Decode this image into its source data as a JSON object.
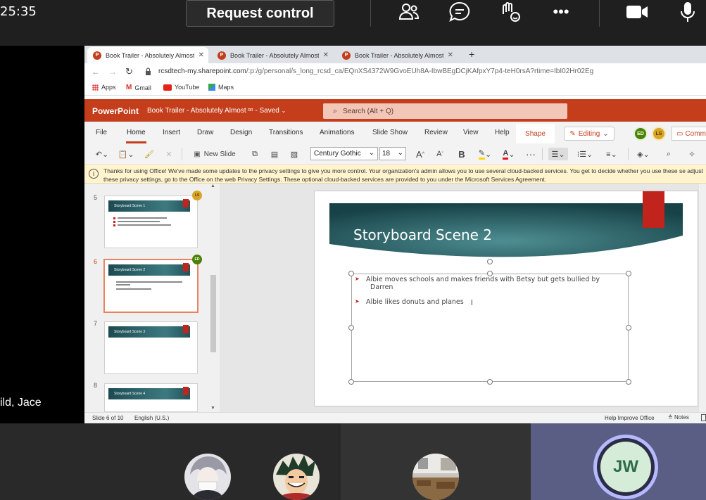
{
  "teams": {
    "call_timer": "25:35",
    "request_control": "Request control",
    "participant_name": "ild, Jace",
    "jw_initials": "JW"
  },
  "browser": {
    "tabs": [
      {
        "label": "Book Trailer - Absolutely Almost",
        "favicon": "P"
      },
      {
        "label": "Book Trailer - Absolutely Almost",
        "favicon": "P"
      },
      {
        "label": "Book Trailer - Absolutely Almost",
        "favicon": "P"
      }
    ],
    "address_host": "rcsdtech-my.sharepoint.com",
    "address_path": "/:p:/g/personal/s_long_rcsd_ca/EQnXS4372W9GvoEUh8A-IbwBEgDCjKAfpxY7p4-teH0rsA?rtime=IbI02Hr02Eg",
    "bookmarks": [
      "Apps",
      "Gmail",
      "YouTube",
      "Maps"
    ]
  },
  "ppt": {
    "brand": "PowerPoint",
    "doc_title": "Book Trailer - Absolutely Almost",
    "saved": "- Saved",
    "search_placeholder": "Search (Alt + Q)",
    "ribbon_tabs": [
      "File",
      "Home",
      "Insert",
      "Draw",
      "Design",
      "Transitions",
      "Animations",
      "Slide Show",
      "Review",
      "View",
      "Help"
    ],
    "shape_tab": "Shape",
    "editing": "Editing",
    "comments": "Comm",
    "coauthors": [
      {
        "initials": "ED",
        "color": "#498205"
      },
      {
        "initials": "LS",
        "color": "#a66c00"
      }
    ],
    "new_slide": "New Slide",
    "font": "Century Gothic",
    "font_size": "18",
    "notice": "Thanks for using Office! We've made some updates to the privacy settings to give you more control. Your organization's admin allows you to use several cloud-backed services. You get to decide whether you use these se adjust these privacy settings, go to the Office on the web Privacy Settings. These optional cloud-backed services are provided to you under the Microsoft Services Agreement.",
    "thumbnails": [
      {
        "num": "5",
        "title": "Storyboard Scene 1",
        "badge": "LS"
      },
      {
        "num": "6",
        "title": "Storyboard Scene 2",
        "badge": "ED"
      },
      {
        "num": "7",
        "title": "Storyboard Scene 3",
        "badge": ""
      },
      {
        "num": "8",
        "title": "Storyboard Scene 4",
        "badge": ""
      }
    ],
    "slide": {
      "title": "Storyboard Scene 2",
      "bullets": [
        "Albie moves schools and makes friends with Betsy but gets bullied by Darren",
        "Albie likes donuts and planes"
      ]
    },
    "status": {
      "slide_count": "Slide 6 of 10",
      "language": "English (U.S.)",
      "help_improve": "Help Improve Office",
      "notes": "Notes"
    }
  },
  "colors": {
    "ppt_accent": "#c43e1c",
    "slide_banner": "#1c4a52",
    "flag": "#c0241c"
  }
}
